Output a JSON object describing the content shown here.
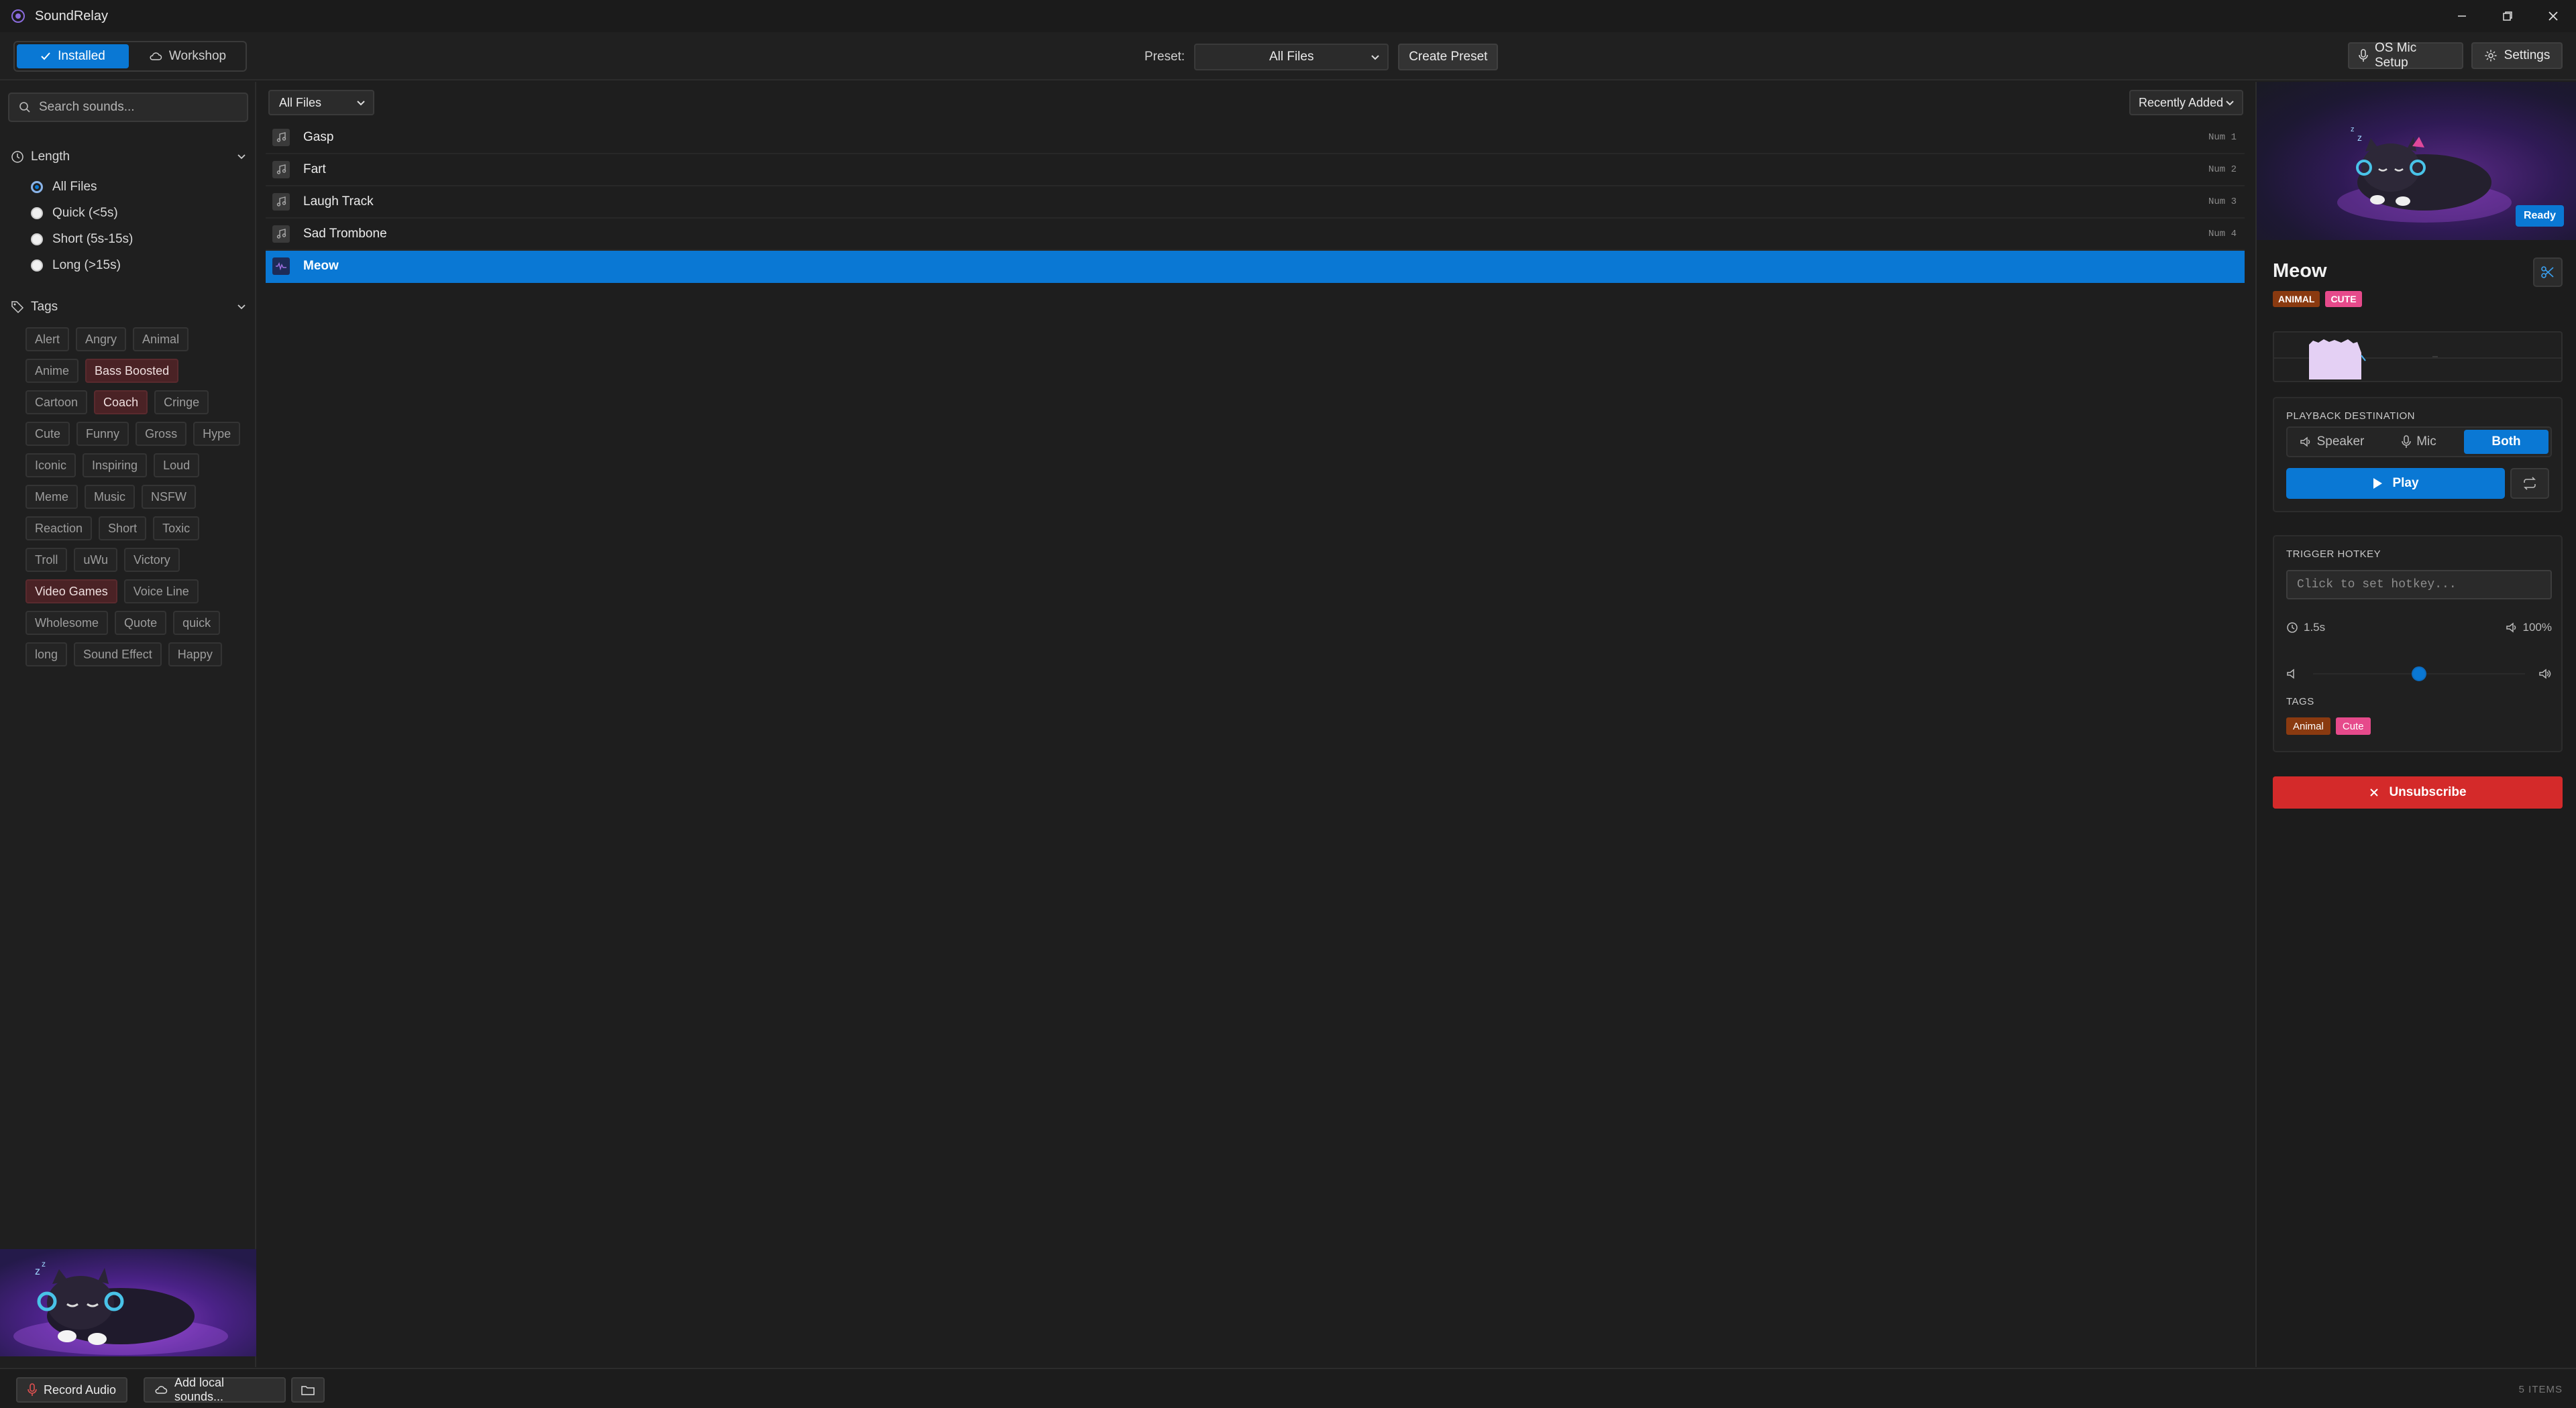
{
  "window": {
    "title": "SoundRelay"
  },
  "toolbar": {
    "tabs": [
      {
        "label": "Installed"
      },
      {
        "label": "Workshop"
      }
    ],
    "preset_label": "Preset:",
    "preset_value": "All Files",
    "create_preset": "Create Preset",
    "os_mic_setup": "OS Mic Setup",
    "settings": "Settings"
  },
  "sidebar": {
    "search_placeholder": "Search sounds...",
    "length": {
      "title": "Length",
      "options": [
        "All Files",
        "Quick (<5s)",
        "Short (5s-15s)",
        "Long (>15s)"
      ],
      "selected": "All Files"
    },
    "tags": {
      "title": "Tags",
      "items": [
        "Alert",
        "Angry",
        "Animal",
        "Anime",
        "Bass Boosted",
        "Cartoon",
        "Coach",
        "Cringe",
        "Cute",
        "Funny",
        "Gross",
        "Hype",
        "Iconic",
        "Inspiring",
        "Loud",
        "Meme",
        "Music",
        "NSFW",
        "Reaction",
        "Short",
        "Toxic",
        "Troll",
        "uWu",
        "Victory",
        "Video Games",
        "Voice Line",
        "Wholesome",
        "Quote",
        "quick",
        "long",
        "Sound Effect",
        "Happy"
      ],
      "highlighted": [
        "Bass Boosted",
        "Coach",
        "Video Games"
      ]
    }
  },
  "main": {
    "filter": "All Files",
    "sort": "Recently Added",
    "rows": [
      {
        "name": "Gasp",
        "hotkey": "Num 1"
      },
      {
        "name": "Fart",
        "hotkey": "Num 2"
      },
      {
        "name": "Laugh Track",
        "hotkey": "Num 3"
      },
      {
        "name": "Sad Trombone",
        "hotkey": "Num 4"
      },
      {
        "name": "Meow",
        "hotkey": ""
      }
    ],
    "selected": "Meow"
  },
  "panel": {
    "status": "Ready",
    "title": "Meow",
    "badges": [
      "ANIMAL",
      "CUTE"
    ],
    "playback_caption": "PLAYBACK DESTINATION",
    "destinations": [
      "Speaker",
      "Mic",
      "Both"
    ],
    "destination_selected": "Both",
    "play": "Play",
    "hotkey_caption": "TRIGGER HOTKEY",
    "hotkey_placeholder": "Click to set hotkey...",
    "duration": "1.5s",
    "volume": "100%",
    "volume_level": 0.5,
    "tags_caption": "TAGS",
    "tags": [
      "Animal",
      "Cute"
    ],
    "unsubscribe": "Unsubscribe"
  },
  "statusbar": {
    "record": "Record Audio",
    "add_local": "Add local sounds...",
    "count": "5 ITEMS"
  },
  "colors": {
    "accent": "#0a78d4",
    "danger": "#d42a2a",
    "tag_highlight": "#4a2225",
    "badge_animal": "#8a3a10",
    "badge_cute": "#e64a8b"
  }
}
